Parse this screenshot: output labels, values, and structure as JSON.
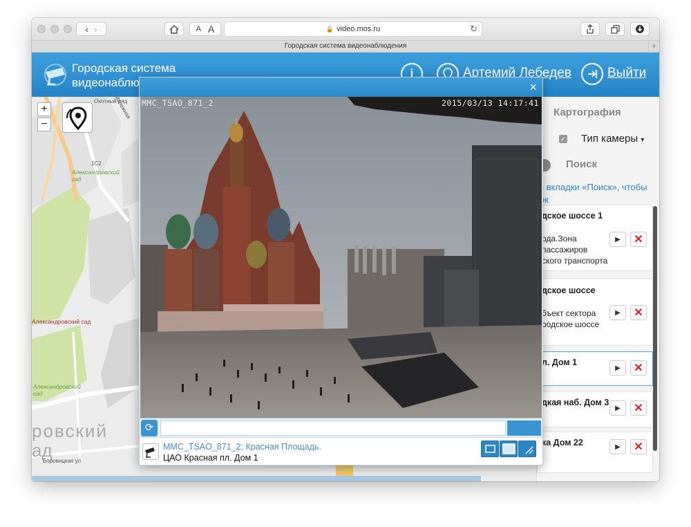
{
  "browser": {
    "url": "video.mos.ru",
    "tab_title": "Городская система видеонаблюдения",
    "text_small_a": "A",
    "text_large_a": "A",
    "new_tab": "+"
  },
  "header": {
    "title_line1": "Городская система",
    "title_line2": "видеонаблю",
    "user_name": "Артемий Лебедев",
    "logout": "Выйти"
  },
  "map": {
    "zoom_in": "+",
    "zoom_out": "−",
    "labels": {
      "label_1": "Охотный ряд",
      "label_2": "1С2",
      "label_3": "Александровский сад",
      "label_4": "Александровский сад",
      "label_5": "Александровский сад",
      "label_6": "ровский",
      "label_7": "ад",
      "label_8": "Боровицкая ул",
      "label_9": "Манежная"
    }
  },
  "panel": {
    "tab_cartography": "Картография",
    "camera_type": "Тип камеры",
    "tab_search": "Поиск",
    "hint_line1": "з вкладки «Поиск», чтобы",
    "hint_line2": "ок",
    "cameras": [
      {
        "title": "дское шоссе 1",
        "desc_line1": "ода.Зона",
        "desc_line2": "пассажиров",
        "desc_line3": "ского транспорта"
      },
      {
        "title": "дское шоссе",
        "desc_line1": "бъект сектора",
        "desc_line2": "родское шоссе",
        "desc_line3": ""
      },
      {
        "title": "л. Дом 1",
        "desc_line1": ".",
        "desc_line2": "",
        "desc_line3": ""
      },
      {
        "title": "дкая наб. Дом 3",
        "desc_line1": "",
        "desc_line2": "",
        "desc_line3": ""
      },
      {
        "title": "ка Дом 22",
        "desc_line1": "",
        "desc_line2": "",
        "desc_line3": ""
      }
    ]
  },
  "modal": {
    "close": "×",
    "osd_camera": "MMC_TSAO_871_2",
    "osd_timestamp": "2015/03/13 14:17:41",
    "camera_name": "MMC_TSAO_871_2; Красная Площадь.",
    "camera_address": "ЦАО Красная пл. Дом 1"
  },
  "colors": {
    "header_blue": "#2e8fd0",
    "modal_blue": "#2b8ac6",
    "close_red": "#d8232a"
  }
}
